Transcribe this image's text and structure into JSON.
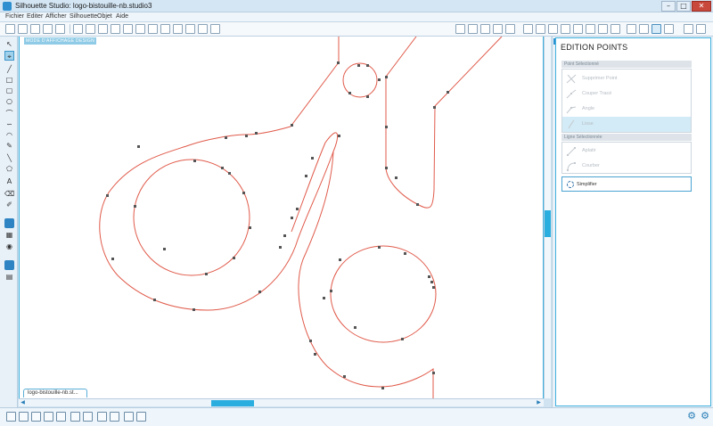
{
  "window": {
    "title": "Silhouette Studio: logo-bistouille-nb.studio3",
    "minimize": "–",
    "maximize": "□",
    "close": "✕"
  },
  "menu": [
    "Fichier",
    "Editer",
    "Afficher",
    "Silhouette",
    "Objet",
    "Aide"
  ],
  "canvas": {
    "mode_tag": "MODE D'AFFICHAGE DESIGN",
    "document_tab": "logo-bistouille-nb.st...",
    "path_color": "#e05a4a",
    "node_color": "#555555"
  },
  "panel": {
    "title": "EDITION POINTS",
    "collapse_icon": "»",
    "point_section": {
      "header": "Point Sélectionné",
      "items": [
        {
          "label": "Supprimer Point",
          "icon": "delete-point-icon"
        },
        {
          "label": "Couper Tracé",
          "icon": "cut-path-icon"
        },
        {
          "label": "Angle",
          "icon": "corner-icon"
        },
        {
          "label": "Lisse",
          "icon": "smooth-icon",
          "selected": true
        }
      ]
    },
    "line_section": {
      "header": "Ligne Sélectionnée",
      "items": [
        {
          "label": "Aplatir",
          "icon": "flatten-icon"
        },
        {
          "label": "Courber",
          "icon": "curve-icon"
        }
      ]
    },
    "simplify": {
      "label": "Simplifier",
      "icon": "simplify-icon"
    }
  },
  "accent": "#2aaee0"
}
